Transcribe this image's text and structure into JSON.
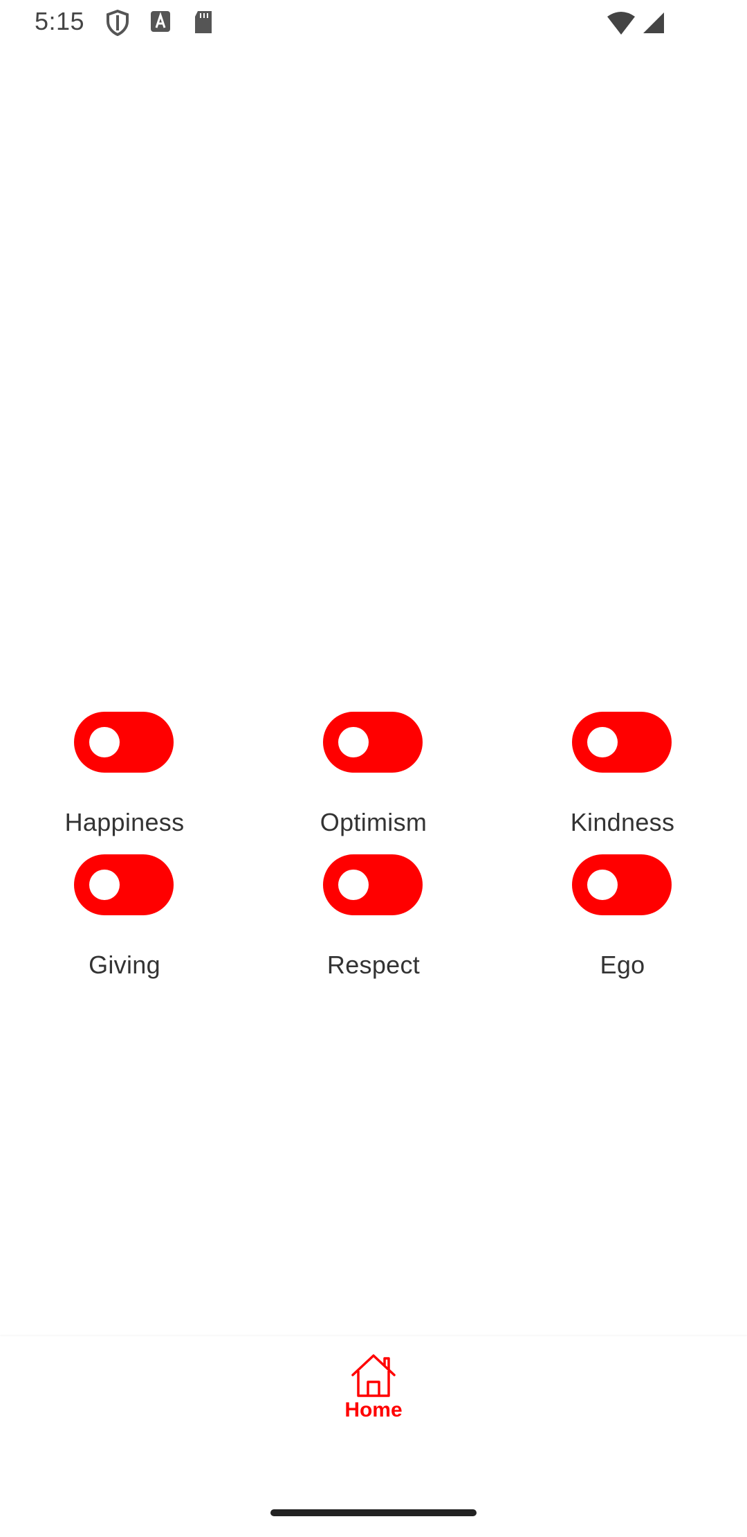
{
  "status_bar": {
    "time": "5:15",
    "icons": [
      "shield-icon",
      "a-icon",
      "sd-card-icon",
      "wifi-icon",
      "signal-icon"
    ]
  },
  "toggles": [
    {
      "label": "Happiness",
      "on": true
    },
    {
      "label": "Optimism",
      "on": true
    },
    {
      "label": "Kindness",
      "on": true
    },
    {
      "label": "Giving",
      "on": true
    },
    {
      "label": "Respect",
      "on": true
    },
    {
      "label": "Ego",
      "on": true
    }
  ],
  "bottom_nav": {
    "home_label": "Home",
    "home_icon": "home-icon"
  },
  "colors": {
    "accent": "#ff0000",
    "text": "#333333",
    "background": "#ffffff"
  }
}
